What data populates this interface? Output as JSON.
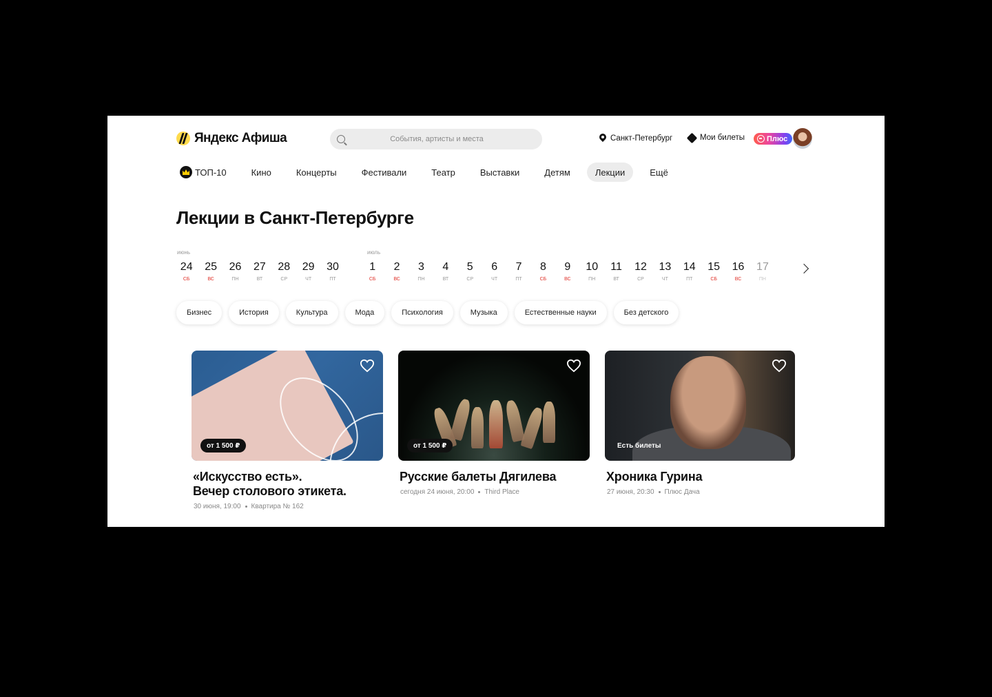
{
  "header": {
    "logo": "Яндекс Афиша",
    "search_placeholder": "События, артисты и места",
    "city": "Санкт-Петербург",
    "my_tickets": "Мои билеты",
    "plus": "Плюс"
  },
  "nav": {
    "items": [
      {
        "label": "ТОП-10"
      },
      {
        "label": "Кино"
      },
      {
        "label": "Концерты"
      },
      {
        "label": "Фестивали"
      },
      {
        "label": "Театр"
      },
      {
        "label": "Выставки"
      },
      {
        "label": "Детям"
      },
      {
        "label": "Лекции",
        "active": true
      },
      {
        "label": "Ещё"
      }
    ]
  },
  "page_title": "Лекции в Санкт-Петербурге",
  "calendar": {
    "months": [
      {
        "name": "июнь",
        "days": [
          {
            "num": "24",
            "wd": "сб",
            "weekend": true
          },
          {
            "num": "25",
            "wd": "вс",
            "weekend": true
          },
          {
            "num": "26",
            "wd": "пн"
          },
          {
            "num": "27",
            "wd": "вт"
          },
          {
            "num": "28",
            "wd": "ср"
          },
          {
            "num": "29",
            "wd": "чт"
          },
          {
            "num": "30",
            "wd": "пт"
          }
        ]
      },
      {
        "name": "июль",
        "days": [
          {
            "num": "1",
            "wd": "сб",
            "weekend": true
          },
          {
            "num": "2",
            "wd": "вс",
            "weekend": true
          },
          {
            "num": "3",
            "wd": "пн"
          },
          {
            "num": "4",
            "wd": "вт"
          },
          {
            "num": "5",
            "wd": "ср"
          },
          {
            "num": "6",
            "wd": "чт"
          },
          {
            "num": "7",
            "wd": "пт"
          },
          {
            "num": "8",
            "wd": "сб",
            "weekend": true
          },
          {
            "num": "9",
            "wd": "вс",
            "weekend": true
          },
          {
            "num": "10",
            "wd": "пн"
          },
          {
            "num": "11",
            "wd": "вт"
          },
          {
            "num": "12",
            "wd": "ср"
          },
          {
            "num": "13",
            "wd": "чт"
          },
          {
            "num": "14",
            "wd": "пт"
          },
          {
            "num": "15",
            "wd": "сб",
            "weekend": true
          },
          {
            "num": "16",
            "wd": "вс",
            "weekend": true
          },
          {
            "num": "17",
            "wd": "пн",
            "faded": true
          }
        ]
      }
    ]
  },
  "chips": [
    "Бизнес",
    "История",
    "Культура",
    "Мода",
    "Психология",
    "Музыка",
    "Естественные науки",
    "Без детского"
  ],
  "cards": [
    {
      "badge": "от 1 500 ₽",
      "title_line1": "«Искусство есть».",
      "title_line2": "Вечер столового этикета.",
      "date": "30 июня, 19:00",
      "place": "Квартира № 162"
    },
    {
      "badge": "от 1 500 ₽",
      "title_line1": "Русские балеты Дягилева",
      "title_line2": "",
      "date": "сегодня 24 июня, 20:00",
      "place": "Third Place"
    },
    {
      "badge": "Есть билеты",
      "title_line1": "Хроника Гурина",
      "title_line2": "",
      "date": "27 июня, 20:30",
      "place": "Плюс Дача"
    }
  ]
}
